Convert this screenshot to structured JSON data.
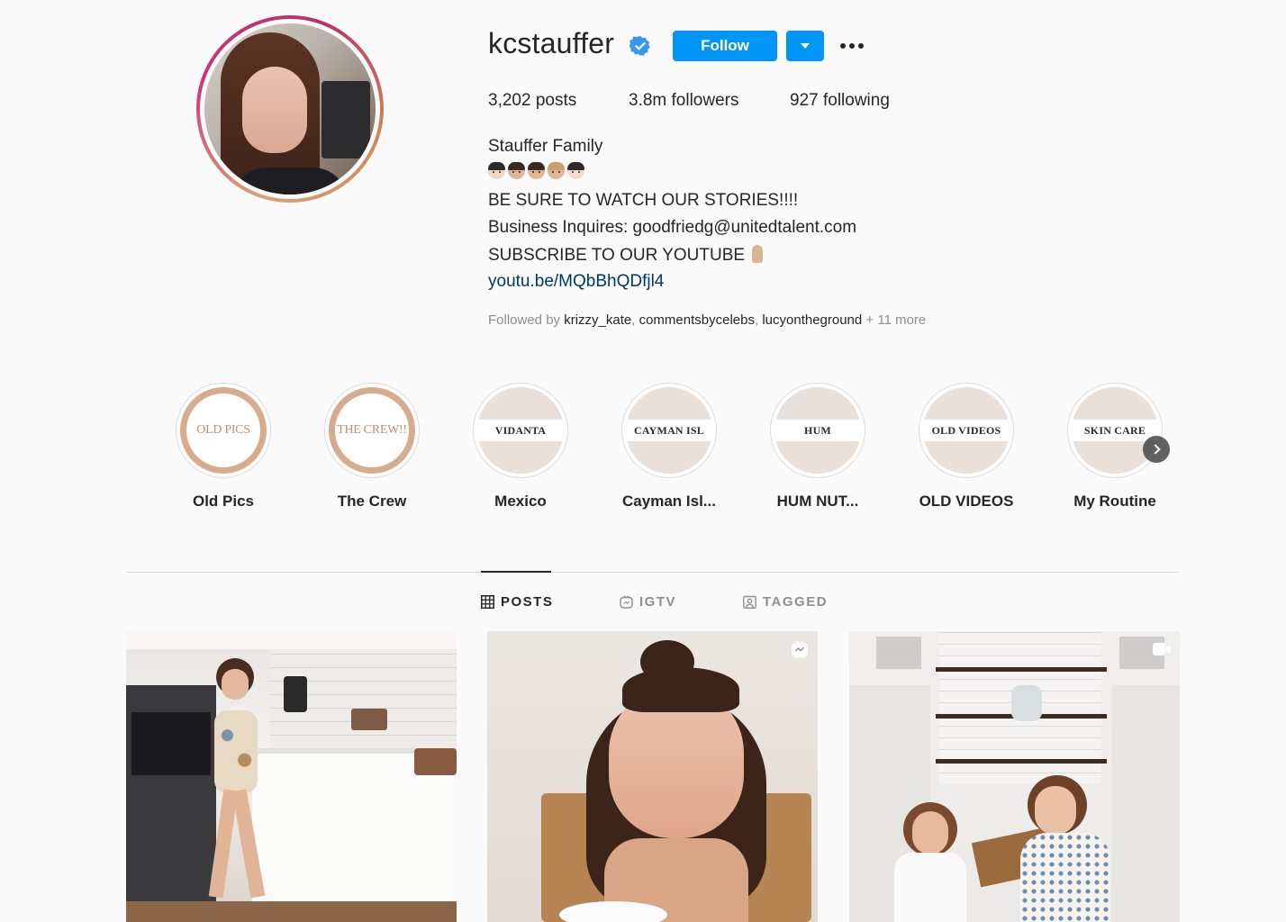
{
  "profile": {
    "username": "kcstauffer",
    "verified": true,
    "follow_label": "Follow",
    "stats": {
      "posts": "3,202 posts",
      "followers": "3.8m followers",
      "following": "927 following"
    },
    "bio": {
      "name": "Stauffer Family",
      "line_stories": "BE SURE TO WATCH OUR STORIES!!!!",
      "line_business": "Business Inquires: goodfriedg@unitedtalent.com",
      "line_subscribe": "SUBSCRIBE TO OUR YOUTUBE",
      "link": "youtu.be/MQbBhQDfjl4"
    },
    "followed_by": {
      "prefix": "Followed by",
      "names": [
        "krizzy_kate",
        "commentsbycelebs",
        "lucyontheground"
      ],
      "more": "+ 11 more"
    }
  },
  "highlights": [
    {
      "label": "Old Pics",
      "cover_text": "OLD PICS",
      "style": "ring"
    },
    {
      "label": "The Crew",
      "cover_text": "THE CREW!!",
      "style": "ring"
    },
    {
      "label": "Mexico",
      "cover_text": "VIDANTA",
      "style": "band"
    },
    {
      "label": "Cayman Isl...",
      "cover_text": "CAYMAN ISL",
      "style": "band"
    },
    {
      "label": "HUM NUT...",
      "cover_text": "HUM",
      "style": "band"
    },
    {
      "label": "OLD VIDEOS",
      "cover_text": "OLD VIDEOS",
      "style": "band"
    },
    {
      "label": "My Routine",
      "cover_text": "SKIN CARE",
      "style": "band"
    }
  ],
  "tabs": [
    {
      "label": "POSTS",
      "active": true,
      "icon": "grid-icon"
    },
    {
      "label": "IGTV",
      "active": false,
      "icon": "igtv-icon"
    },
    {
      "label": "TAGGED",
      "active": false,
      "icon": "tagged-icon"
    }
  ],
  "posts": [
    {
      "subject": "girl-in-kitchen",
      "badge": null
    },
    {
      "subject": "girl-at-table",
      "badge": "igtv-icon"
    },
    {
      "subject": "girls-in-kitchen",
      "badge": "video-icon"
    }
  ],
  "colors": {
    "accent": "#0095f6",
    "text": "#262626",
    "muted": "#8e8e8e",
    "link": "#00376b",
    "background": "#fafafa"
  }
}
